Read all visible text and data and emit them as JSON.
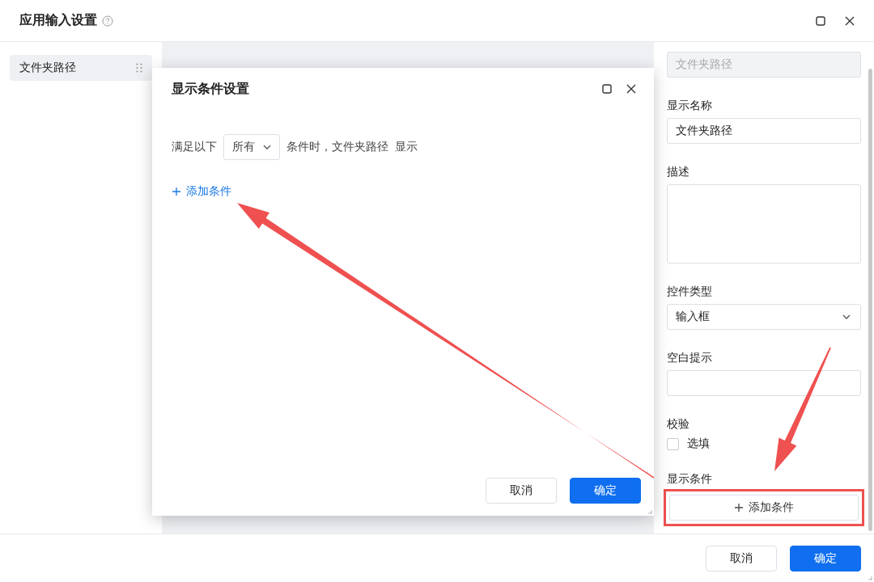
{
  "window": {
    "title": "应用输入设置"
  },
  "sidebar": {
    "items": [
      {
        "label": "文件夹路径",
        "selected": true
      }
    ]
  },
  "properties": {
    "fields": [
      {
        "kind": "input",
        "value": "文件夹路径",
        "disabled": true
      },
      {
        "kind": "input",
        "label": "显示名称",
        "value": "文件夹路径",
        "disabled": false
      },
      {
        "kind": "textarea",
        "label": "描述"
      },
      {
        "kind": "select",
        "label": "控件类型",
        "value": "输入框"
      },
      {
        "kind": "input",
        "label": "空白提示",
        "disabled": false
      },
      {
        "kind": "checkbox",
        "label": "校验",
        "option": "选填",
        "checked": false
      },
      {
        "kind": "button",
        "label": "显示条件",
        "button": "添加条件",
        "highlighted": true
      }
    ]
  },
  "dialog": {
    "title": "显示条件设置",
    "condition": {
      "prefix": "满足以下",
      "match": "所有",
      "suffix": "条件时，文件夹路径",
      "action": "显示"
    },
    "add_condition": "添加条件",
    "buttons": [
      {
        "label": "取消",
        "kind": "default"
      },
      {
        "label": "确定",
        "kind": "primary"
      }
    ]
  },
  "footer": {
    "buttons": [
      {
        "label": "取消",
        "kind": "default"
      },
      {
        "label": "确定",
        "kind": "primary"
      }
    ]
  }
}
